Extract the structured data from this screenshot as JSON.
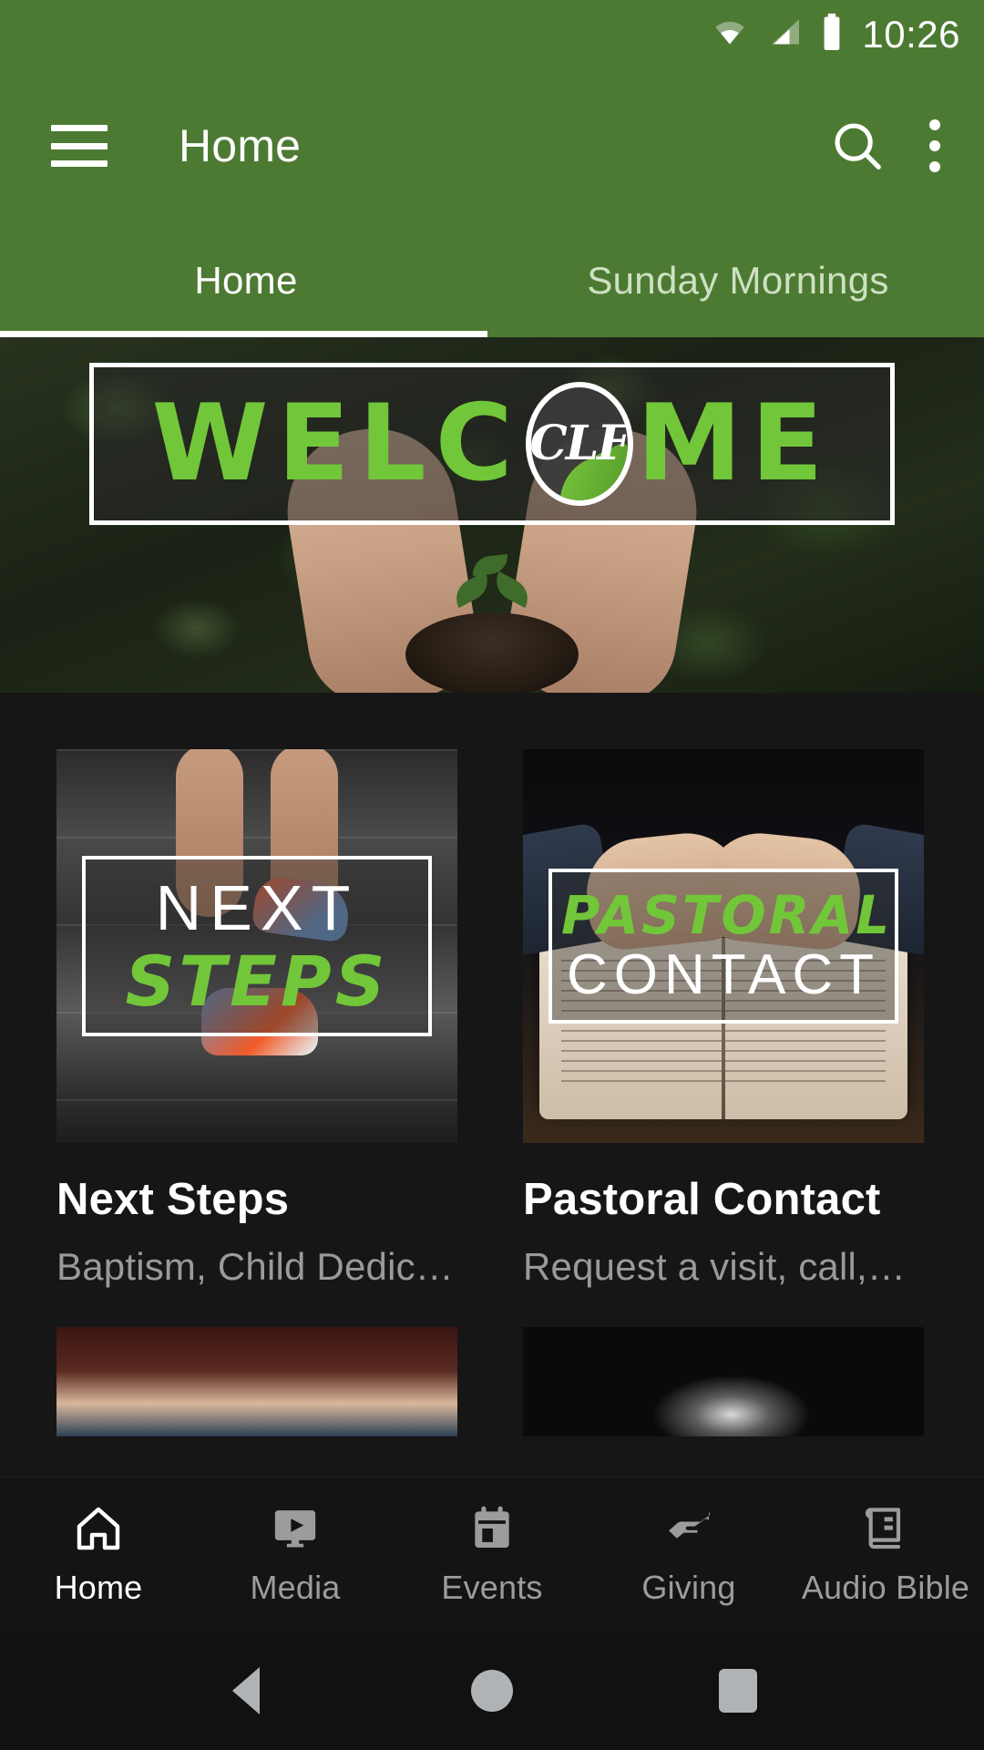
{
  "theme": {
    "brand_green": "#4C7A33",
    "accent_green": "#72C639",
    "background_dark": "#161616",
    "text_primary": "#ffffff",
    "text_secondary": "#9a9a9a"
  },
  "status_bar": {
    "time": "10:26",
    "wifi_icon": "wifi-icon",
    "cellular_icon": "cellular-signal-icon",
    "battery_icon": "battery-full-icon"
  },
  "app_bar": {
    "menu_icon": "hamburger-menu-icon",
    "title": "Home",
    "search_icon": "search-icon",
    "overflow_icon": "overflow-menu-icon"
  },
  "tabs": {
    "active_index": 0,
    "items": [
      {
        "label": "Home"
      },
      {
        "label": "Sunday Mornings"
      }
    ]
  },
  "hero": {
    "overlay_text_pre": "WELC",
    "overlay_text_post": "ME",
    "logo_text": "CLF",
    "logo_icon": "clf-logo-circle-icon",
    "alt": "Hands holding soil with sprout"
  },
  "cards": [
    {
      "overlay_line1": "NEXT",
      "overlay_line2": "STEPS",
      "title": "Next Steps",
      "subtitle": "Baptism, Child Dedic…",
      "image_alt": "Feet climbing concrete stairs"
    },
    {
      "overlay_line1": "PASTORAL",
      "overlay_line2": "CONTACT",
      "title": "Pastoral Contact",
      "subtitle": "Request a visit, call,…",
      "image_alt": "Hands folded on an open Bible"
    }
  ],
  "bottom_nav": {
    "active_index": 0,
    "items": [
      {
        "label": "Home",
        "icon": "home-icon"
      },
      {
        "label": "Media",
        "icon": "media-play-icon"
      },
      {
        "label": "Events",
        "icon": "calendar-icon"
      },
      {
        "label": "Giving",
        "icon": "giving-hand-icon"
      },
      {
        "label": "Audio Bible",
        "icon": "book-icon"
      }
    ]
  },
  "system_nav": {
    "back": "back-icon",
    "home": "home-circle-icon",
    "recents": "recents-square-icon"
  }
}
